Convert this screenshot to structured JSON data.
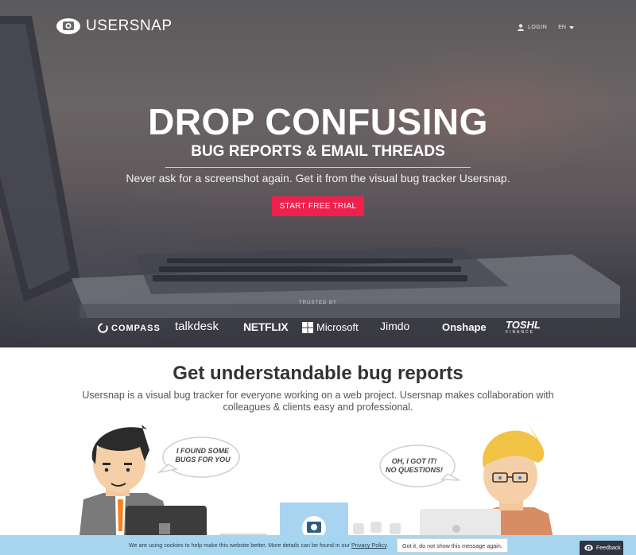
{
  "header": {
    "logo_text": "USERSNAP",
    "login_label": "LOGIN",
    "language": "EN"
  },
  "hero": {
    "headline": "DROP CONFUSING",
    "subheadline": "BUG REPORTS & EMAIL THREADS",
    "tagline": "Never ask for a screenshot again. Get it from the visual bug tracker Usersnap.",
    "cta_label": "START FREE TRIAL",
    "trusted_label": "TRUSTED BY",
    "brands": {
      "compass": "COMPASS",
      "talkdesk": "talkdesk",
      "netflix": "NETFLIX",
      "microsoft": "Microsoft",
      "jimdo": "Jimdo",
      "onshape": "Onshape",
      "toshl": "TOSHL",
      "toshl_sub": "FINANCE"
    }
  },
  "section": {
    "title": "Get understandable bug reports",
    "description": "Usersnap is a visual bug tracker for everyone working on a web project. Usersnap makes collaboration with colleagues & clients easy and professional."
  },
  "illustration": {
    "bubble_left_line1": "I FOUND SOME",
    "bubble_left_line2": "BUGS FOR YOU",
    "bubble_right_line1": "OH, I GOT IT!",
    "bubble_right_line2": "NO QUESTIONS!"
  },
  "cookie_bar": {
    "text": "We are using cookies to help make this website better. More details can be found in our",
    "link": "Privacy Policy",
    "button": "Got it, do not show this message again."
  },
  "feedback_label": "Feedback",
  "colors": {
    "cta": "#f0204d",
    "cookie_bar": "#a6d6ef",
    "feedback_tab": "#2e3440"
  }
}
